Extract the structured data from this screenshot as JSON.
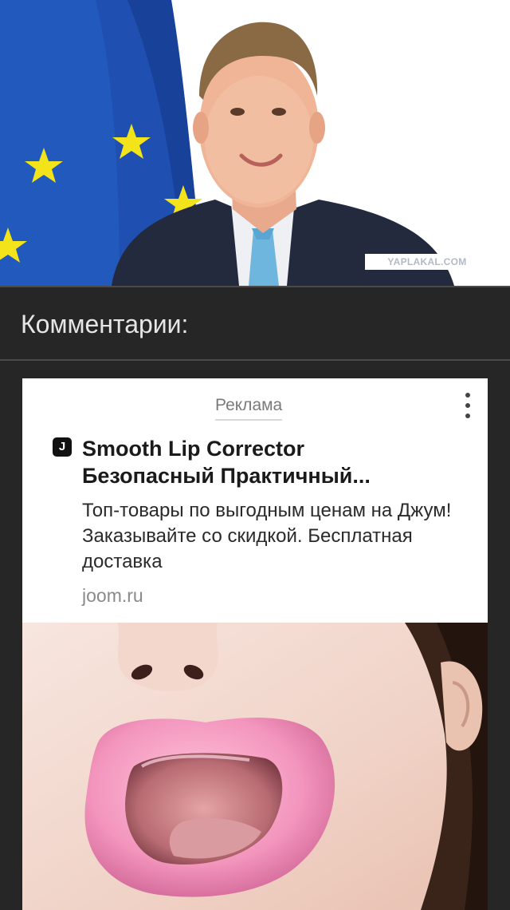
{
  "photo": {
    "watermark": "YAPLAKAL.COM",
    "colors": {
      "flag_blue": "#1f4fb0",
      "star_yellow": "#f3e31a",
      "suit": "#242a3d",
      "tie": "#6fb6de"
    }
  },
  "comments": {
    "title": "Комментарии:"
  },
  "ad": {
    "label": "Реклама",
    "menu_icon": "kebab-menu-icon",
    "brand_icon_glyph": "J",
    "title_line1": "Smooth Lip Corrector",
    "title_line2": "Безопасный Практичный...",
    "description": "Топ-товары по выгодным ценам на Джум! Заказывайте со скидкой. Бесплатная доставка",
    "domain": "joom.ru",
    "image_subject": "face-with-lip-corrector"
  }
}
